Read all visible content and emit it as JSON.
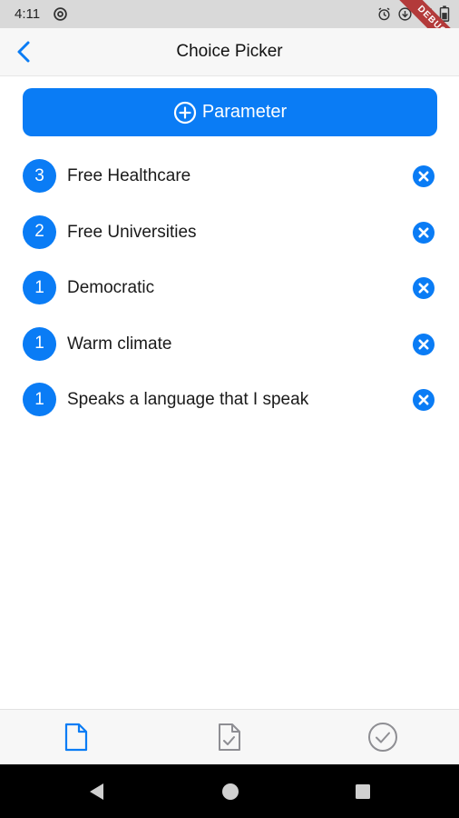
{
  "status_bar": {
    "time": "4:11",
    "icons": [
      "at-sign-icon",
      "alarm-icon",
      "download-icon",
      "signal-icon",
      "battery-icon"
    ],
    "debug_banner": "DEBUG"
  },
  "app_bar": {
    "title": "Choice Picker",
    "back_icon": "chevron-left-icon"
  },
  "add_button": {
    "label": "Parameter",
    "icon": "plus-circle-icon"
  },
  "parameters": [
    {
      "rank": "3",
      "label": "Free Healthcare"
    },
    {
      "rank": "2",
      "label": "Free Universities"
    },
    {
      "rank": "1",
      "label": "Democratic"
    },
    {
      "rank": "1",
      "label": "Warm climate"
    },
    {
      "rank": "1",
      "label": "Speaks a language that I speak"
    }
  ],
  "tab_bar": {
    "tabs": [
      {
        "icon": "document-icon",
        "active": true
      },
      {
        "icon": "document-check-icon",
        "active": false
      },
      {
        "icon": "check-circle-icon",
        "active": false
      }
    ]
  },
  "nav_bar": {
    "buttons": [
      "back-triangle-icon",
      "home-circle-icon",
      "recents-square-icon"
    ]
  },
  "colors": {
    "accent": "#0a7cf5",
    "status_bar": "#d9d9d9",
    "app_bar": "#f7f7f7",
    "inactive_icon": "#8e8e93",
    "nav_bar": "#000000"
  }
}
